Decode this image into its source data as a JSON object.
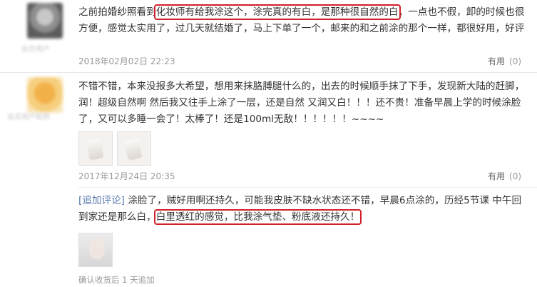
{
  "reviews": [
    {
      "text_before": "之前拍婚纱照看到",
      "text_highlight": "化妆师有给我涂这个，涂完真的有白，是那种很自然的白",
      "text_after": "，一点也不假，卸的时候也很方便，感觉太实用了，过几天就结婚了，马上下单了一个，邮来的和之前涂的那个一样，都很好用，好评",
      "date": "2018年02月02日 22:23",
      "helpful_label": "有用",
      "helpful_count": "(0)"
    },
    {
      "text": "不错不错，本来没报多大希望，想用来抹胳膊腿什么的，出去的时候顺手抹了下手，发现新大陆的赶脚，润！超级自然啊 然后我又往手上涂了一层，还是自然 又润又白！！！还不贵！准备早晨上学的时候涂脸了，又可以多睡一会了！太棒了！还是100ml无敌！！！！！！~~~~",
      "date": "2017年12月24日 20:35",
      "helpful_label": "有用",
      "helpful_count": "(0)",
      "followup": {
        "label": "[追加评论]",
        "text_before": "涂脸了，贼好用啊还持久，可能我皮肤不缺水状态还不错，早晨6点涂的，历经5节课 中午回到家还是那么白，",
        "text_highlight": "白里透红的感觉，比我涂气垫、粉底液还持久！",
        "footer": "确认收货后 1 天追加"
      }
    }
  ],
  "colors": {
    "highlight": "#d0202a"
  }
}
